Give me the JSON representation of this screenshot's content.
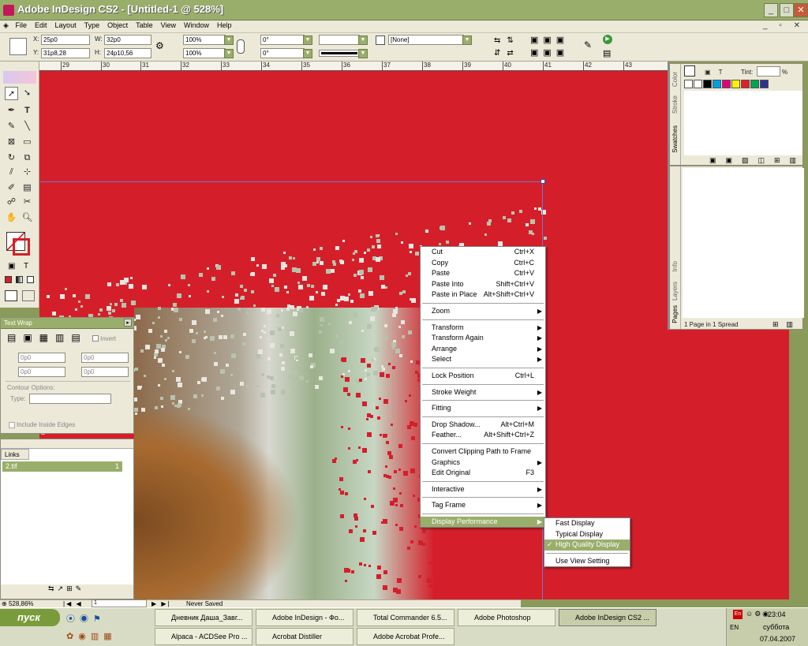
{
  "window": {
    "title": "Adobe InDesign CS2 - [Untitled-1 @ 528%]",
    "min": "_",
    "max": "□",
    "close": "✕"
  },
  "menubar": [
    "File",
    "Edit",
    "Layout",
    "Type",
    "Object",
    "Table",
    "View",
    "Window",
    "Help"
  ],
  "control": {
    "x_label": "X:",
    "x": "25p0",
    "y_label": "Y:",
    "y": "31p8,28",
    "w_label": "W:",
    "w": "32p0",
    "h_label": "H:",
    "h": "24p10,56",
    "scale_x": "100%",
    "scale_y": "100%",
    "rotate": "0°",
    "shear": "0°",
    "object_style": "[None]"
  },
  "ruler": [
    "29",
    "30",
    "31",
    "32",
    "33",
    "34",
    "35",
    "36",
    "37",
    "38",
    "39",
    "40",
    "41",
    "42",
    "43"
  ],
  "swatches_panel": {
    "tint_label": "Tint:",
    "tint_unit": "%",
    "tabs": [
      "Swatches",
      "Stroke",
      "Color"
    ],
    "colors": [
      "#ffffff",
      "#000000",
      "#00a0e0",
      "#e0007a",
      "#fff200",
      "#e31e24",
      "#00a651",
      "#2e3192"
    ]
  },
  "pages_panel": {
    "tabs": [
      "Pages",
      "Layers",
      "Info"
    ],
    "status": "1 Page in 1 Spread"
  },
  "text_wrap": {
    "title": "Text Wrap",
    "invert": "Invert",
    "zero": "0p0",
    "contour_label": "Contour Options:",
    "type_label": "Type:",
    "include_inside": "Include Inside Edges"
  },
  "links": {
    "title": "Links",
    "file": "2.tif",
    "page": "1"
  },
  "status": {
    "zoom": "528,86%",
    "page": "1",
    "saved": "Never Saved"
  },
  "context_menu": [
    {
      "label": "Cut",
      "shortcut": "Ctrl+X"
    },
    {
      "label": "Copy",
      "shortcut": "Ctrl+C"
    },
    {
      "label": "Paste",
      "shortcut": "Ctrl+V"
    },
    {
      "label": "Paste Into",
      "shortcut": "Shift+Ctrl+V"
    },
    {
      "label": "Paste in Place",
      "shortcut": "Alt+Shift+Ctrl+V"
    },
    {
      "sep": true
    },
    {
      "label": "Zoom",
      "sub": true
    },
    {
      "sep": true
    },
    {
      "label": "Transform",
      "sub": true
    },
    {
      "label": "Transform Again",
      "sub": true
    },
    {
      "label": "Arrange",
      "sub": true
    },
    {
      "label": "Select",
      "sub": true
    },
    {
      "sep": true
    },
    {
      "label": "Lock Position",
      "shortcut": "Ctrl+L"
    },
    {
      "sep": true
    },
    {
      "label": "Stroke Weight",
      "sub": true
    },
    {
      "sep": true
    },
    {
      "label": "Fitting",
      "sub": true
    },
    {
      "sep": true
    },
    {
      "label": "Drop Shadow...",
      "shortcut": "Alt+Ctrl+M"
    },
    {
      "label": "Feather...",
      "shortcut": "Alt+Shift+Ctrl+Z"
    },
    {
      "sep": true
    },
    {
      "label": "Convert Clipping Path to Frame"
    },
    {
      "label": "Graphics",
      "sub": true
    },
    {
      "label": "Edit Original",
      "shortcut": "F3"
    },
    {
      "sep": true
    },
    {
      "label": "Interactive",
      "sub": true
    },
    {
      "sep": true
    },
    {
      "label": "Tag Frame",
      "sub": true
    },
    {
      "sep": true
    },
    {
      "label": "Display Performance",
      "sub": true,
      "highlight": true
    }
  ],
  "submenu": [
    {
      "label": "Fast Display"
    },
    {
      "label": "Typical Display"
    },
    {
      "label": "High Quality Display",
      "checked": true
    },
    {
      "sep": true
    },
    {
      "label": "Use View Setting"
    }
  ],
  "taskbar": {
    "start": "пуск",
    "row1": [
      "Дневник Даша_Завг...",
      "Adobe InDesign - Фо...",
      "Total Commander 6.5...",
      "Adobe Photoshop",
      "Adobe InDesign CS2 ..."
    ],
    "row2": [
      "Alpaca - ACDSee Pro ...",
      "Acrobat Distiller",
      "Adobe Acrobat Profe..."
    ],
    "active_index": 4,
    "lang": "EN",
    "lang2": "En",
    "time": "23:04",
    "day": "суббота",
    "date": "07.04.2007"
  },
  "colors": {
    "accent": "#9aae6b",
    "canvas": "#d41f2b"
  }
}
